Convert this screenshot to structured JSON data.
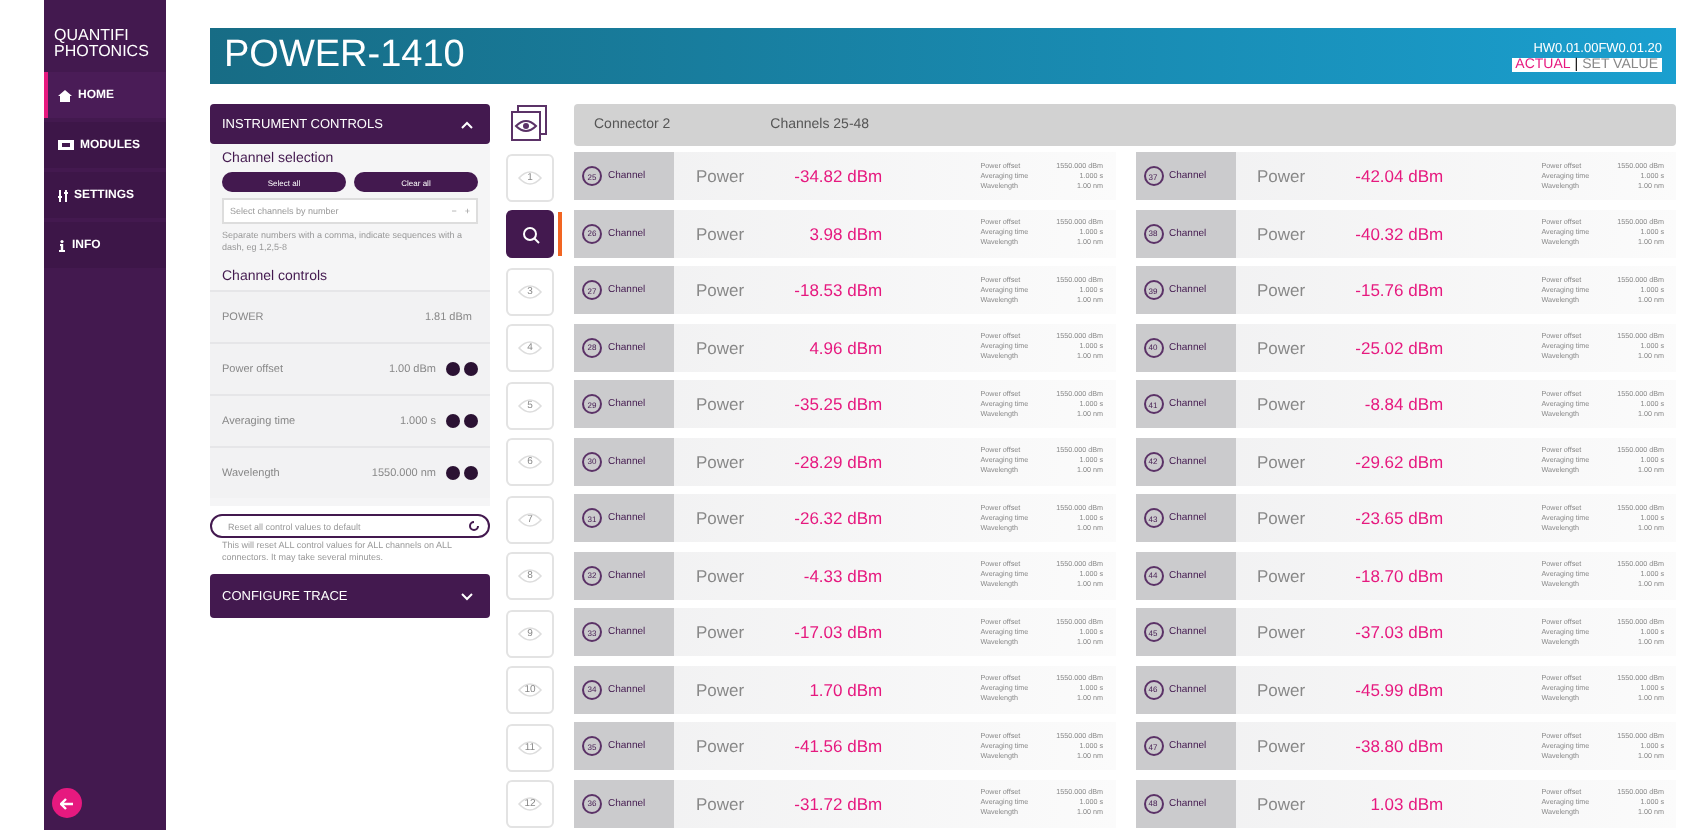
{
  "sidebar": {
    "logo": [
      "QUANTIFI",
      "PHOTONICS"
    ],
    "items": [
      {
        "label": "HOME",
        "selected": true
      },
      {
        "label": "MODULES",
        "selected": false
      },
      {
        "label": "SETTINGS",
        "selected": false
      },
      {
        "label": "INFO",
        "selected": false
      }
    ]
  },
  "header": {
    "title": "**POWER**-1410",
    "version": "HW0.01.00FW0.01.20",
    "separator": "|",
    "modes": [
      {
        "label": "ACTUAL",
        "selected": true
      },
      {
        "label": "SET VALUE",
        "selected": false
      }
    ]
  },
  "instrument_controls": {
    "title": "INSTRUMENT CONTROLS",
    "expanded": true,
    "selection_title": "Channel selection",
    "buttons": [
      "Select all",
      "Clear all"
    ],
    "channel_field": {
      "placeholder": "Select channels by number",
      "minus": "−",
      "plus": "+"
    },
    "hint": "Separate numbers with a comma, indicate sequences with a dash, eg 1,2,5-8",
    "controls_title": "Channel controls",
    "controls": [
      {
        "label": "POWER",
        "value": "1.81 dBm",
        "kind": "readout"
      },
      {
        "label": "Power offset",
        "value": "1.00 dBm",
        "kind": "stepper"
      },
      {
        "label": "Averaging time",
        "value": "1.000 s",
        "kind": "stepper"
      },
      {
        "label": "Wavelength",
        "value": "1550.000 nm",
        "kind": "stepper"
      }
    ],
    "reset": "Reset all control values to default",
    "reset_note": "This will reset ALL control values for ALL channels on ALL connectors. It may take several minutes."
  },
  "configure_trace": {
    "title": "CONFIGURE TRACE",
    "expanded": false
  },
  "connectors": [
    {
      "label": "1",
      "selected": false
    },
    {
      "selected": true
    },
    {
      "label": "3",
      "selected": false
    },
    {
      "label": "4",
      "selected": false
    },
    {
      "label": "5",
      "selected": false
    },
    {
      "label": "6",
      "selected": false
    },
    {
      "label": "7",
      "selected": false
    },
    {
      "label": "8",
      "selected": false
    },
    {
      "label": "9",
      "selected": false
    },
    {
      "label": "10",
      "selected": false
    },
    {
      "label": "11",
      "selected": false
    },
    {
      "label": "12",
      "selected": false
    }
  ],
  "connector_bar": {
    "connector": "Connector 2",
    "channels": "Channels 25-48"
  },
  "columns": [
    [
      {
        "number": "25",
        "label": "Channel",
        "power_label": "Power",
        "power": "-34.82 dBm",
        "params": [
          {
            "label": "Power offset",
            "value": "1550.000 dBm"
          },
          {
            "label": "Averaging time",
            "value": "1.000 s"
          },
          {
            "label": "Wavelength",
            "value": "1.00 nm"
          }
        ]
      },
      {
        "number": "26",
        "label": "Channel",
        "power_label": "Power",
        "power": "3.98 dBm",
        "params": [
          {
            "label": "Power offset",
            "value": "1550.000 dBm"
          },
          {
            "label": "Averaging time",
            "value": "1.000 s"
          },
          {
            "label": "Wavelength",
            "value": "1.00 nm"
          }
        ]
      },
      {
        "number": "27",
        "label": "Channel",
        "power_label": "Power",
        "power": "-18.53 dBm",
        "params": [
          {
            "label": "Power offset",
            "value": "1550.000 dBm"
          },
          {
            "label": "Averaging time",
            "value": "1.000 s"
          },
          {
            "label": "Wavelength",
            "value": "1.00 nm"
          }
        ]
      },
      {
        "number": "28",
        "label": "Channel",
        "power_label": "Power",
        "power": "4.96 dBm",
        "params": [
          {
            "label": "Power offset",
            "value": "1550.000 dBm"
          },
          {
            "label": "Averaging time",
            "value": "1.000 s"
          },
          {
            "label": "Wavelength",
            "value": "1.00 nm"
          }
        ]
      },
      {
        "number": "29",
        "label": "Channel",
        "power_label": "Power",
        "power": "-35.25 dBm",
        "params": [
          {
            "label": "Power offset",
            "value": "1550.000 dBm"
          },
          {
            "label": "Averaging time",
            "value": "1.000 s"
          },
          {
            "label": "Wavelength",
            "value": "1.00 nm"
          }
        ]
      },
      {
        "number": "30",
        "label": "Channel",
        "power_label": "Power",
        "power": "-28.29 dBm",
        "params": [
          {
            "label": "Power offset",
            "value": "1550.000 dBm"
          },
          {
            "label": "Averaging time",
            "value": "1.000 s"
          },
          {
            "label": "Wavelength",
            "value": "1.00 nm"
          }
        ]
      },
      {
        "number": "31",
        "label": "Channel",
        "power_label": "Power",
        "power": "-26.32 dBm",
        "params": [
          {
            "label": "Power offset",
            "value": "1550.000 dBm"
          },
          {
            "label": "Averaging time",
            "value": "1.000 s"
          },
          {
            "label": "Wavelength",
            "value": "1.00 nm"
          }
        ]
      },
      {
        "number": "32",
        "label": "Channel",
        "power_label": "Power",
        "power": "-4.33 dBm",
        "params": [
          {
            "label": "Power offset",
            "value": "1550.000 dBm"
          },
          {
            "label": "Averaging time",
            "value": "1.000 s"
          },
          {
            "label": "Wavelength",
            "value": "1.00 nm"
          }
        ]
      },
      {
        "number": "33",
        "label": "Channel",
        "power_label": "Power",
        "power": "-17.03 dBm",
        "params": [
          {
            "label": "Power offset",
            "value": "1550.000 dBm"
          },
          {
            "label": "Averaging time",
            "value": "1.000 s"
          },
          {
            "label": "Wavelength",
            "value": "1.00 nm"
          }
        ]
      },
      {
        "number": "34",
        "label": "Channel",
        "power_label": "Power",
        "power": "1.70 dBm",
        "params": [
          {
            "label": "Power offset",
            "value": "1550.000 dBm"
          },
          {
            "label": "Averaging time",
            "value": "1.000 s"
          },
          {
            "label": "Wavelength",
            "value": "1.00 nm"
          }
        ]
      },
      {
        "number": "35",
        "label": "Channel",
        "power_label": "Power",
        "power": "-41.56 dBm",
        "params": [
          {
            "label": "Power offset",
            "value": "1550.000 dBm"
          },
          {
            "label": "Averaging time",
            "value": "1.000 s"
          },
          {
            "label": "Wavelength",
            "value": "1.00 nm"
          }
        ]
      },
      {
        "number": "36",
        "label": "Channel",
        "power_label": "Power",
        "power": "-31.72 dBm",
        "params": [
          {
            "label": "Power offset",
            "value": "1550.000 dBm"
          },
          {
            "label": "Averaging time",
            "value": "1.000 s"
          },
          {
            "label": "Wavelength",
            "value": "1.00 nm"
          }
        ]
      }
    ],
    [
      {
        "number": "37",
        "label": "Channel",
        "power_label": "Power",
        "power": "-42.04 dBm",
        "params": [
          {
            "label": "Power offset",
            "value": "1550.000 dBm"
          },
          {
            "label": "Averaging time",
            "value": "1.000 s"
          },
          {
            "label": "Wavelength",
            "value": "1.00 nm"
          }
        ]
      },
      {
        "number": "38",
        "label": "Channel",
        "power_label": "Power",
        "power": "-40.32 dBm",
        "params": [
          {
            "label": "Power offset",
            "value": "1550.000 dBm"
          },
          {
            "label": "Averaging time",
            "value": "1.000 s"
          },
          {
            "label": "Wavelength",
            "value": "1.00 nm"
          }
        ]
      },
      {
        "number": "39",
        "label": "Channel",
        "power_label": "Power",
        "power": "-15.76 dBm",
        "params": [
          {
            "label": "Power offset",
            "value": "1550.000 dBm"
          },
          {
            "label": "Averaging time",
            "value": "1.000 s"
          },
          {
            "label": "Wavelength",
            "value": "1.00 nm"
          }
        ]
      },
      {
        "number": "40",
        "label": "Channel",
        "power_label": "Power",
        "power": "-25.02 dBm",
        "params": [
          {
            "label": "Power offset",
            "value": "1550.000 dBm"
          },
          {
            "label": "Averaging time",
            "value": "1.000 s"
          },
          {
            "label": "Wavelength",
            "value": "1.00 nm"
          }
        ]
      },
      {
        "number": "41",
        "label": "Channel",
        "power_label": "Power",
        "power": "-8.84 dBm",
        "params": [
          {
            "label": "Power offset",
            "value": "1550.000 dBm"
          },
          {
            "label": "Averaging time",
            "value": "1.000 s"
          },
          {
            "label": "Wavelength",
            "value": "1.00 nm"
          }
        ]
      },
      {
        "number": "42",
        "label": "Channel",
        "power_label": "Power",
        "power": "-29.62 dBm",
        "params": [
          {
            "label": "Power offset",
            "value": "1550.000 dBm"
          },
          {
            "label": "Averaging time",
            "value": "1.000 s"
          },
          {
            "label": "Wavelength",
            "value": "1.00 nm"
          }
        ]
      },
      {
        "number": "43",
        "label": "Channel",
        "power_label": "Power",
        "power": "-23.65 dBm",
        "params": [
          {
            "label": "Power offset",
            "value": "1550.000 dBm"
          },
          {
            "label": "Averaging time",
            "value": "1.000 s"
          },
          {
            "label": "Wavelength",
            "value": "1.00 nm"
          }
        ]
      },
      {
        "number": "44",
        "label": "Channel",
        "power_label": "Power",
        "power": "-18.70 dBm",
        "params": [
          {
            "label": "Power offset",
            "value": "1550.000 dBm"
          },
          {
            "label": "Averaging time",
            "value": "1.000 s"
          },
          {
            "label": "Wavelength",
            "value": "1.00 nm"
          }
        ]
      },
      {
        "number": "45",
        "label": "Channel",
        "power_label": "Power",
        "power": "-37.03 dBm",
        "params": [
          {
            "label": "Power offset",
            "value": "1550.000 dBm"
          },
          {
            "label": "Averaging time",
            "value": "1.000 s"
          },
          {
            "label": "Wavelength",
            "value": "1.00 nm"
          }
        ]
      },
      {
        "number": "46",
        "label": "Channel",
        "power_label": "Power",
        "power": "-45.99 dBm",
        "params": [
          {
            "label": "Power offset",
            "value": "1550.000 dBm"
          },
          {
            "label": "Averaging time",
            "value": "1.000 s"
          },
          {
            "label": "Wavelength",
            "value": "1.00 nm"
          }
        ]
      },
      {
        "number": "47",
        "label": "Channel",
        "power_label": "Power",
        "power": "-38.80 dBm",
        "params": [
          {
            "label": "Power offset",
            "value": "1550.000 dBm"
          },
          {
            "label": "Averaging time",
            "value": "1.000 s"
          },
          {
            "label": "Wavelength",
            "value": "1.00 nm"
          }
        ]
      },
      {
        "number": "48",
        "label": "Channel",
        "power_label": "Power",
        "power": "1.03 dBm",
        "params": [
          {
            "label": "Power offset",
            "value": "1550.000 dBm"
          },
          {
            "label": "Averaging time",
            "value": "1.000 s"
          },
          {
            "label": "Wavelength",
            "value": "1.00 nm"
          }
        ]
      }
    ]
  ]
}
